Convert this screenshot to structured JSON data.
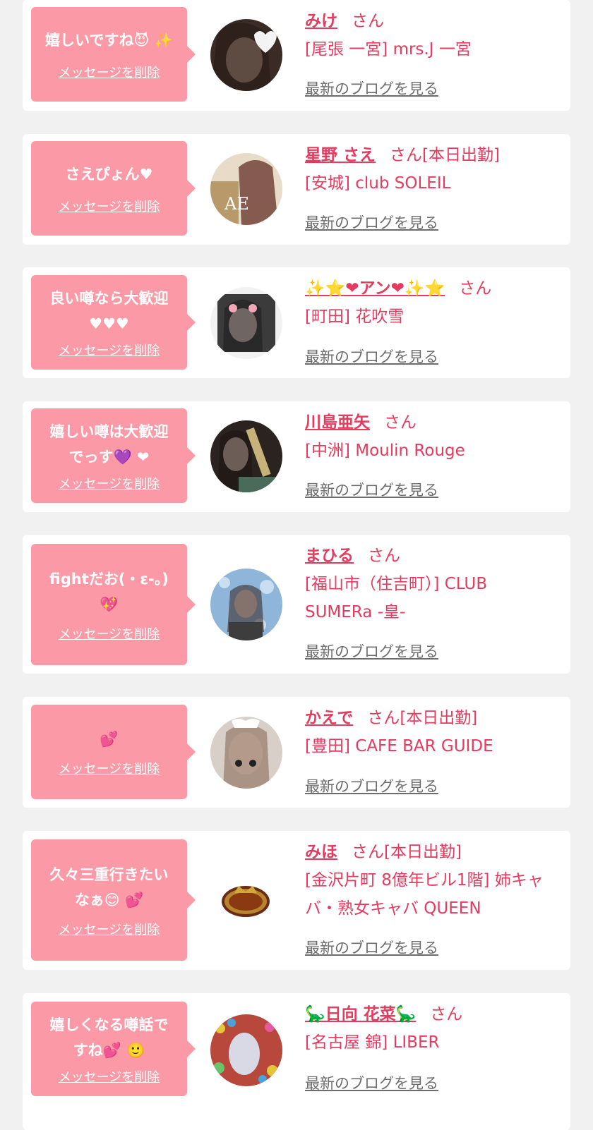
{
  "delete_label": "メッセージを削除",
  "blog_label": "最新のブログを見る",
  "honorific": "さん",
  "colors": {
    "accent": "#e43b5f",
    "bubble": "#fb9aa6",
    "background": "#f1f1f1"
  },
  "items": [
    {
      "message": "嬉しいですね😈 ✨",
      "name": "みけ",
      "status": "",
      "shop": "[尾張 一宮] mrs.J 一宮"
    },
    {
      "message": "さえぴょん♥",
      "name": "星野 さえ",
      "status": "[本日出勤]",
      "shop": "[安城] club SOLEIL"
    },
    {
      "message": "良い噂なら大歓迎\n♥♥♥",
      "name": "✨⭐❤アン❤✨⭐",
      "status": "",
      "shop": "[町田] 花吹雪"
    },
    {
      "message": "嬉しい噂は大歓迎\nでっす💜 ❤",
      "name": "川島亜矢",
      "status": "",
      "shop": "[中洲] Moulin Rouge"
    },
    {
      "message": "fightだお(・ε-。)\n💖",
      "name": "まひる",
      "status": "",
      "shop": "[福山市（住吉町）] CLUB\nSUMERa -皇-"
    },
    {
      "message": "💕",
      "name": "かえで",
      "status": "[本日出勤]",
      "shop": "[豊田] CAFE BAR GUIDE"
    },
    {
      "message": "久々三重行きたい\nなぁ😊 💕",
      "name": "みほ",
      "status": "[本日出勤]",
      "shop": "[金沢片町 8億年ビル1階] 姉キャ\nバ・熟女キャバ QUEEN"
    },
    {
      "message": "嬉しくなる噂話で\nすね💕 🙂",
      "name": "🦕日向 花菜🦕",
      "status": "",
      "shop": "[名古屋 錦] LIBER"
    }
  ]
}
